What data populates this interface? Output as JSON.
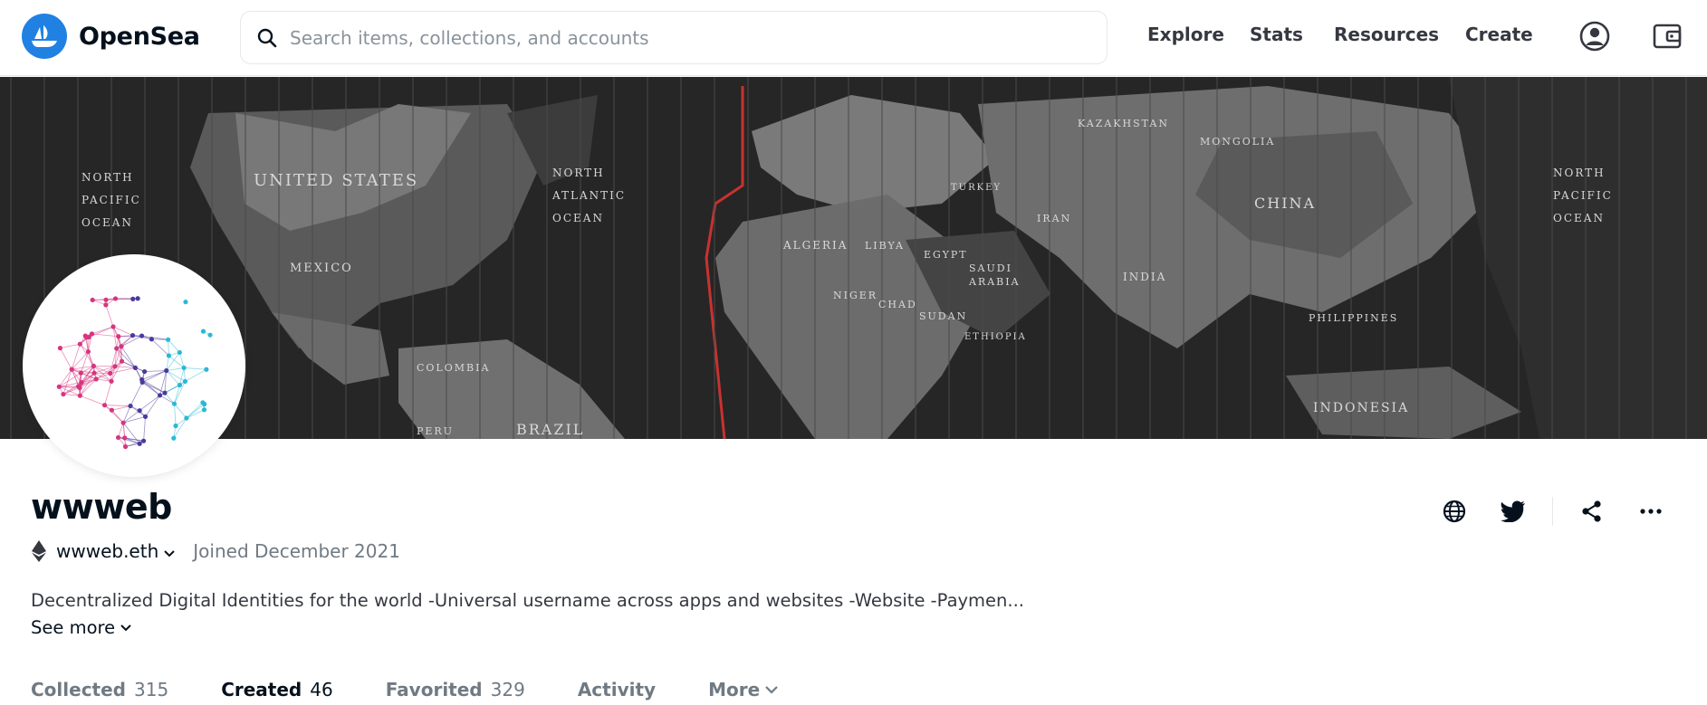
{
  "header": {
    "brand": "OpenSea",
    "search_placeholder": "Search items, collections, and accounts",
    "nav": [
      "Explore",
      "Stats",
      "Resources",
      "Create"
    ]
  },
  "profile": {
    "name": "wwweb",
    "ens": "wwweb.eth",
    "joined": "Joined December 2021",
    "bio": "Decentralized Digital Identities for the world -Universal username across apps and websites -Website -Paymen...",
    "see_more": "See more"
  },
  "tabs": [
    {
      "label": "Collected",
      "count": "315"
    },
    {
      "label": "Created",
      "count": "46",
      "active": true
    },
    {
      "label": "Favorited",
      "count": "329"
    },
    {
      "label": "Activity",
      "count": ""
    },
    {
      "label": "More",
      "count": ""
    }
  ],
  "banner": {
    "map_labels": [
      "UNITED STATES",
      "NORTH",
      "PACIFIC",
      "OCEAN",
      "NORTH",
      "ATLANTIC",
      "OCEAN",
      "MEXICO",
      "BRAZIL",
      "ALGERIA",
      "LIBYA",
      "EGYPT",
      "NIGER",
      "CHAD",
      "SUDAN",
      "SAUDI",
      "ARABIA",
      "IRAN",
      "KAZAKHSTAN",
      "MONGOLIA",
      "CHINA",
      "INDIA",
      "INDONESIA",
      "NORTH",
      "PACIFIC",
      "OCEAN",
      "COLOMBIA",
      "PERU",
      "TURKEY",
      "PHILIPPINES",
      "ETHIOPIA"
    ]
  },
  "colors": {
    "brand_blue": "#2081e2",
    "text_primary": "#04111d",
    "text_secondary": "#707a83",
    "banner_dark": "#2b2b2b"
  },
  "icons": [
    "opensea-logo-icon",
    "search-icon",
    "account-icon",
    "wallet-icon",
    "ethereum-icon",
    "chevron-down-icon",
    "globe-icon",
    "twitter-icon",
    "share-icon",
    "more-icon"
  ]
}
